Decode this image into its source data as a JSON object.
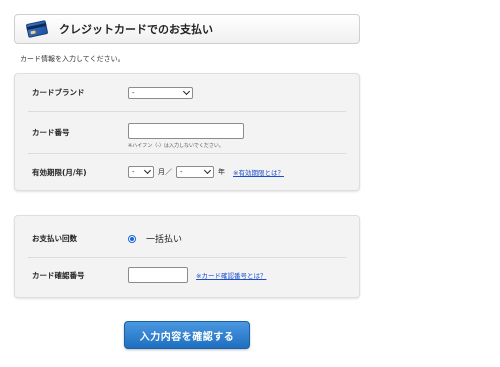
{
  "header": {
    "title": "クレジットカードでのお支払い",
    "icon": "credit-card-icon"
  },
  "instruction": "カード情報を入力してください。",
  "card_form": {
    "brand": {
      "label": "カードブランド",
      "value": "-"
    },
    "number": {
      "label": "カード番号",
      "value": "",
      "note": "※ハイフン（-）は入力しないでください。"
    },
    "expiry": {
      "label": "有効期限(月/年)",
      "month_value": "-",
      "month_unit": "月／",
      "year_value": "-",
      "year_unit": "年",
      "help_link": "※有効期限とは？"
    }
  },
  "payment_form": {
    "installments": {
      "label": "お支払い回数",
      "option": "一括払い",
      "selected": true
    },
    "security_code": {
      "label": "カード確認番号",
      "value": "",
      "help_link": "※カード確認番号とは？"
    }
  },
  "confirm_button": "入力内容を確認する",
  "colors": {
    "accent": "#1f6fc1",
    "link": "#1a4fc9",
    "panel_bg": "#f3f3f3"
  }
}
